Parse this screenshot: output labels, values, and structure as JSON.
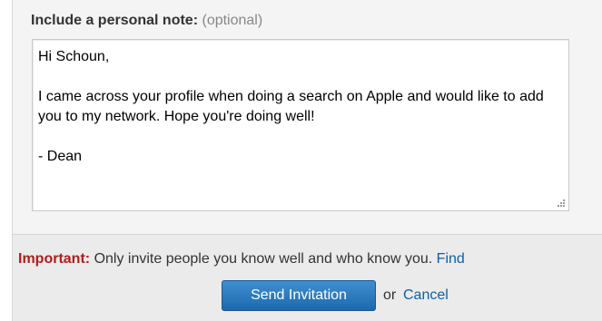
{
  "note": {
    "label": "Include a personal note:",
    "optional": "(optional)",
    "message": "Hi Schoun,\n\nI came across your profile when doing a search on Apple and would like to add you to my network. Hope you're doing well!\n\n- Dean"
  },
  "footer": {
    "important_label": "Important:",
    "important_text": "Only invite people you know well and who know you.",
    "find_link": "Find",
    "send_button": "Send Invitation",
    "or_text": "or",
    "cancel_link": "Cancel"
  },
  "colors": {
    "important_red": "#b31b1b",
    "link_blue": "#0e5fa8",
    "button_blue": "#2b78bd"
  }
}
